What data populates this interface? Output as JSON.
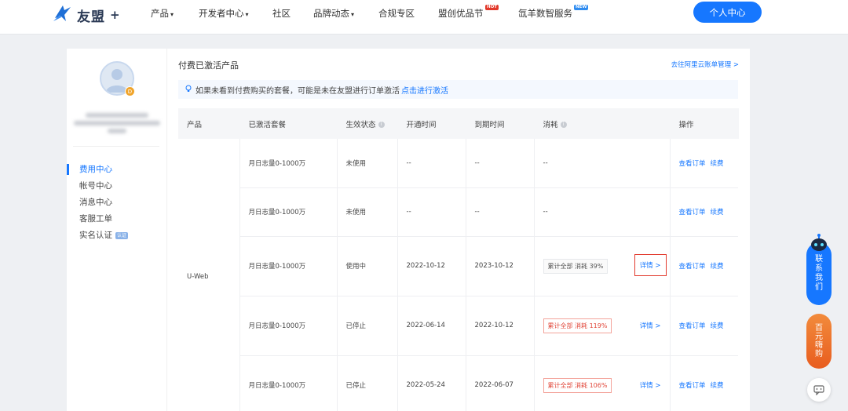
{
  "nav": {
    "logo_text": "友盟",
    "logo_plus": "+",
    "items": [
      {
        "label": "产品",
        "has_caret": true
      },
      {
        "label": "开发者中心",
        "has_caret": true
      },
      {
        "label": "社区",
        "has_caret": false
      },
      {
        "label": "品牌动态",
        "has_caret": true
      },
      {
        "label": "合规专区",
        "has_caret": false
      },
      {
        "label": "盟创优品节",
        "badge": "HOT"
      },
      {
        "label": "氙羊数智服务",
        "badge": "NEW"
      }
    ],
    "caret": "▾",
    "personal_center": "个人中心"
  },
  "sidebar": {
    "menu": [
      {
        "label": "费用中心",
        "active": true
      },
      {
        "label": "帐号中心"
      },
      {
        "label": "消息中心"
      },
      {
        "label": "客服工单"
      },
      {
        "label": "实名认证",
        "tag": "认证"
      }
    ],
    "avatar_badge": "D"
  },
  "content": {
    "title": "付费已激活产品",
    "billing_link": "去往阿里云账单管理 >",
    "notice_text": "如果未看到付费购买的套餐，可能是未在友盟进行订单激活",
    "notice_link": "点击进行激活"
  },
  "table": {
    "headers": {
      "product": "产品",
      "plan": "已激活套餐",
      "status": "生效状态",
      "start": "开通时间",
      "end": "到期时间",
      "consume": "消耗",
      "ops": "操作"
    },
    "product_name": "U-Web",
    "rows": [
      {
        "plan": "月日志量0-1000万",
        "status": "未使用",
        "start": "--",
        "end": "--",
        "consume": "--",
        "detail": ""
      },
      {
        "plan": "月日志量0-1000万",
        "status": "未使用",
        "start": "--",
        "end": "--",
        "consume": "--",
        "detail": ""
      },
      {
        "plan": "月日志量0-1000万",
        "status": "使用中",
        "start": "2022-10-12",
        "end": "2023-10-12",
        "consume": "累计全部 消耗 39%",
        "detail": "详情 >"
      },
      {
        "plan": "月日志量0-1000万",
        "status": "已停止",
        "start": "2022-06-14",
        "end": "2022-10-12",
        "consume": "累计全部 消耗 119%",
        "detail": "详情 >"
      },
      {
        "plan": "月日志量0-1000万",
        "status": "已停止",
        "start": "2022-05-24",
        "end": "2022-06-07",
        "consume": "累计全部 消耗 106%",
        "detail": "详情 >"
      }
    ],
    "op_view": "查看订单",
    "op_renew": "续费"
  },
  "floating": {
    "contact": [
      "联",
      "系",
      "我",
      "们"
    ],
    "promo": [
      "百",
      "元",
      "嗨",
      "购"
    ]
  },
  "colors": {
    "brand": "#1677ff",
    "danger": "#e1473a",
    "hot_badge": "#e2382a",
    "promo": "#e85d1f"
  },
  "icons": {
    "logo": "umeng-logo-icon",
    "bulb": "lightbulb-icon",
    "info": "info-icon",
    "robot": "robot-icon",
    "message": "message-icon"
  }
}
